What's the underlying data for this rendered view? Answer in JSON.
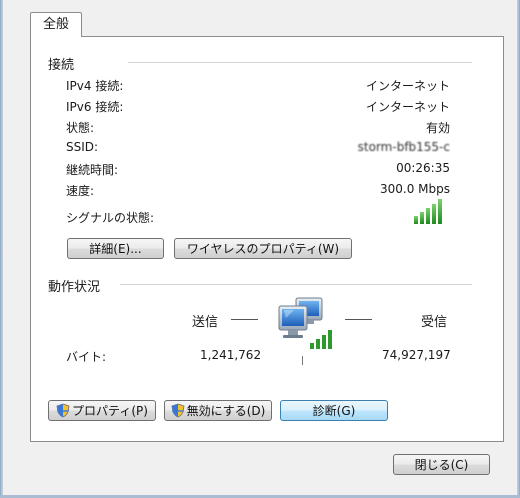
{
  "tabs": [
    {
      "label": "全般"
    }
  ],
  "connection": {
    "section_title": "接続",
    "rows": [
      {
        "label": "IPv4 接続:",
        "value": "インターネット"
      },
      {
        "label": "IPv6 接続:",
        "value": "インターネット"
      },
      {
        "label": "状態:",
        "value": "有効"
      },
      {
        "label": "SSID:",
        "value": "storm-bfb155-c"
      },
      {
        "label": "継続時間:",
        "value": "00:26:35"
      },
      {
        "label": "速度:",
        "value": "300.0 Mbps"
      }
    ],
    "signal_label": "シグナルの状態:",
    "signal_icon": "signal-strength-icon",
    "signal_bars": 5,
    "signal_max": 5,
    "details_button": "詳細(E)...",
    "wireless_props_button": "ワイヤレスのプロパティ(W)"
  },
  "activity": {
    "section_title": "動作状況",
    "sent_label": "送信",
    "received_label": "受信",
    "bytes_label": "バイト:",
    "bytes_sent": "1,241,762",
    "bytes_received": "74,927,197",
    "network_icon": "network-computers-icon"
  },
  "buttons": {
    "properties": "プロパティ(P)",
    "disable": "無効にする(D)",
    "diagnose": "診断(G)",
    "close": "閉じる(C)"
  },
  "colors": {
    "accent": "#3c7fb1",
    "signal_green": "#2e9a2e"
  }
}
